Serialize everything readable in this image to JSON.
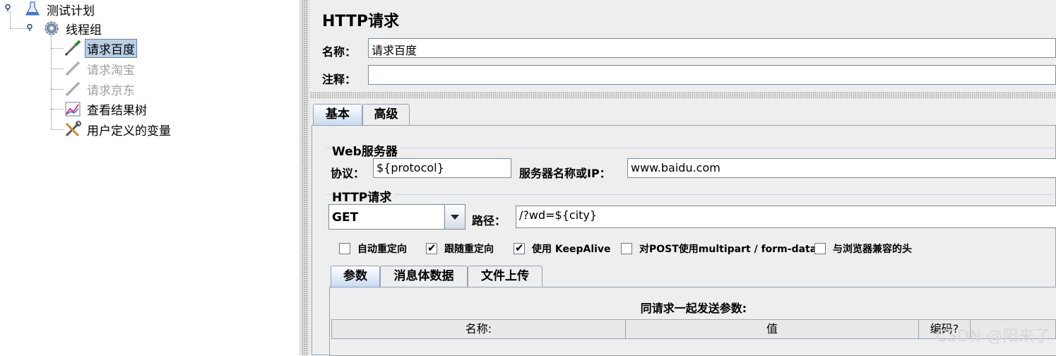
{
  "tree": {
    "items": [
      {
        "label": "测试计划",
        "icon": "flask-icon"
      },
      {
        "label": "线程组",
        "icon": "gear-icon"
      },
      {
        "label": "请求百度",
        "icon": "pipette-icon",
        "selected": true
      },
      {
        "label": "请求淘宝",
        "icon": "pipette-icon",
        "disabled": true
      },
      {
        "label": "请求京东",
        "icon": "pipette-icon",
        "disabled": true
      },
      {
        "label": "查看结果树",
        "icon": "chart-icon"
      },
      {
        "label": "用户定义的变量",
        "icon": "wrench-icon"
      }
    ]
  },
  "panel": {
    "title": "HTTP请求",
    "name_label": "名称：",
    "name_value": "请求百度",
    "comment_label": "注释：",
    "comment_value": "",
    "tabs": [
      "基本",
      "高级"
    ],
    "web_server": {
      "title": "Web服务器",
      "protocol_label": "协议：",
      "protocol_value": "${protocol}",
      "server_label": "服务器名称或IP：",
      "server_value": "www.baidu.com"
    },
    "http_request": {
      "title": "HTTP请求",
      "method": "GET",
      "path_label": "路径：",
      "path_value": "/?wd=${city}"
    },
    "options": [
      {
        "label": "自动重定向",
        "checked": false
      },
      {
        "label": "跟随重定向",
        "checked": true
      },
      {
        "label": "使用 KeepAlive",
        "checked": true
      },
      {
        "label": "对POST使用multipart / form-data",
        "checked": false
      },
      {
        "label": "与浏览器兼容的头",
        "checked": false
      }
    ],
    "sub_tabs": [
      "参数",
      "消息体数据",
      "文件上传"
    ],
    "params": {
      "caption": "同请求一起发送参数:",
      "columns": [
        "名称:",
        "值",
        "编码?"
      ]
    }
  },
  "watermark": "CSDN @阳来了"
}
